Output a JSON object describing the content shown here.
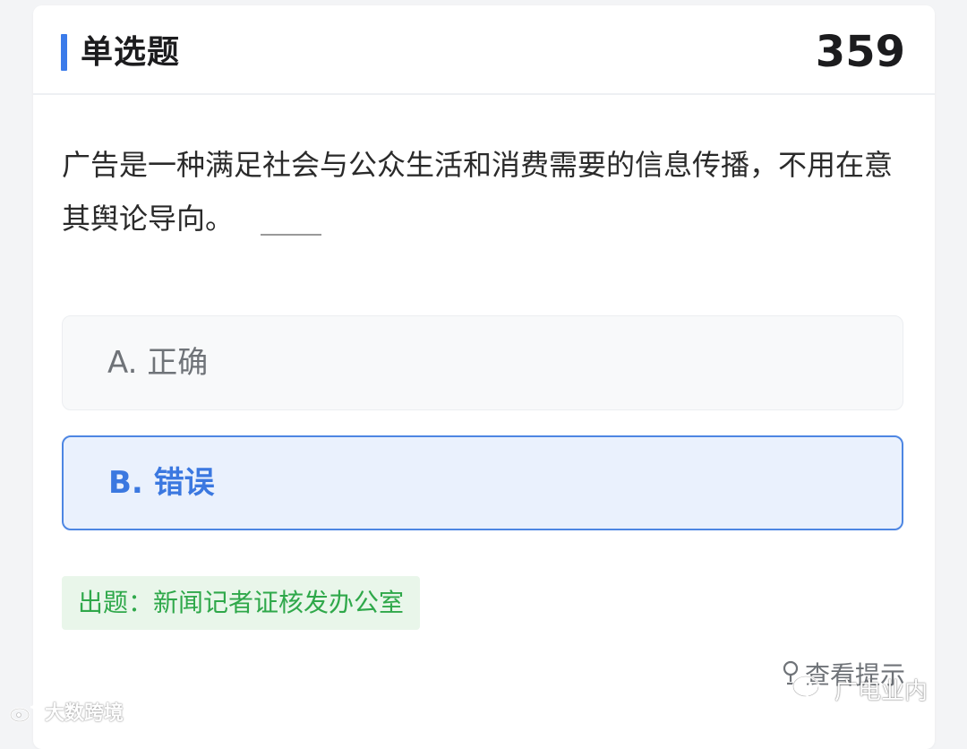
{
  "header": {
    "title": "单选题",
    "number": "359",
    "accent_color": "#3b7bea"
  },
  "question": {
    "text": "广告是一种满足社会与公众生活和消费需要的信息传播，不用在意其舆论导向。"
  },
  "options": [
    {
      "letter": "A.",
      "text": "正确",
      "selected": false
    },
    {
      "letter": "B.",
      "text": "错误",
      "selected": true
    }
  ],
  "source": {
    "label": "出题：新闻记者证核发办公室",
    "color": "#2fa84a"
  },
  "hint": {
    "label": "查看提示",
    "icon": "lightbulb-icon"
  },
  "watermarks": {
    "left": "大数跨境",
    "right": "广电业内",
    "left_icon": "weibo-icon",
    "right_icon": "wechat-icon"
  }
}
